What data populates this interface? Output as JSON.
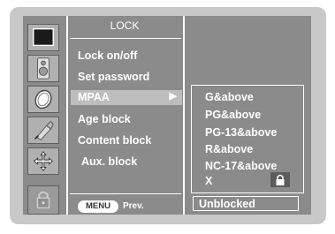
{
  "sidebar": {
    "icons": [
      "tv-picture-icon",
      "speaker-icon",
      "clock-icon",
      "satellite-icon",
      "cross-arrows-icon",
      "padlock-icon"
    ],
    "active": "padlock-icon"
  },
  "menu": {
    "title": "LOCK",
    "items": [
      {
        "label": "Lock on/off"
      },
      {
        "label": "Set password"
      },
      {
        "label": "MPAA",
        "arrow": "▶",
        "selected": true
      },
      {
        "label": "Age block"
      },
      {
        "label": "Content block"
      },
      {
        "label": "Aux. block"
      }
    ]
  },
  "submenu": {
    "options": [
      "G&above",
      "PG&above",
      "PG-13&above",
      "R&above",
      "NC-17&above",
      "X"
    ],
    "locked_option": "X"
  },
  "footer": {
    "menu_button": "MENU",
    "prev_label": "Prev.",
    "status": "Unblocked"
  },
  "colors": {
    "panel": "#8b8b8b",
    "highlight": "#bdbdbd",
    "frame": "#c8c8c8",
    "text": "#ffffff"
  }
}
